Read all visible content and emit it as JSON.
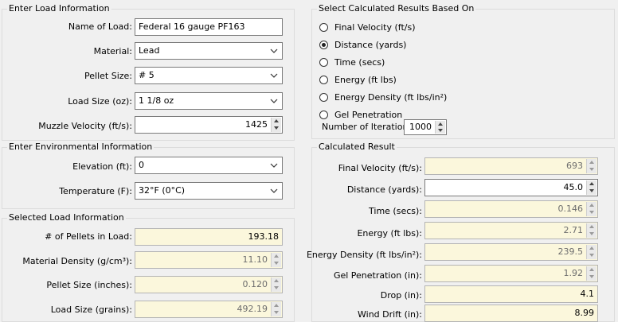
{
  "load_info": {
    "title": "Enter Load Information",
    "name_label": "Name of Load:",
    "name_value": "Federal 16 gauge PF163",
    "material_label": "Material:",
    "material_value": "Lead",
    "pellet_size_label": "Pellet Size:",
    "pellet_size_value": "# 5",
    "load_size_label": "Load Size (oz):",
    "load_size_value": "1 1/8 oz",
    "muzzle_velocity_label": "Muzzle Velocity (ft/s):",
    "muzzle_velocity_value": "1425"
  },
  "environment": {
    "title": "Enter Environmental Information",
    "elevation_label": "Elevation (ft):",
    "elevation_value": "0",
    "temperature_label": "Temperature (F):",
    "temperature_value": "32°F (0°C)"
  },
  "selected_load": {
    "title": "Selected Load Information",
    "pellets_label": "# of Pellets in Load:",
    "pellets_value": "193.18",
    "density_label": "Material Density (g/cm³):",
    "density_value": "11.10",
    "pellet_inches_label": "Pellet Size (inches):",
    "pellet_inches_value": "0.120",
    "grains_label": "Load Size (grains):",
    "grains_value": "492.19"
  },
  "select_results": {
    "title": "Select Calculated Results Based On",
    "options": [
      {
        "label": "Final Velocity (ft/s)",
        "selected": false
      },
      {
        "label": "Distance (yards)",
        "selected": true
      },
      {
        "label": "Time (secs)",
        "selected": false
      },
      {
        "label": "Energy (ft lbs)",
        "selected": false
      },
      {
        "label": "Energy Density (ft lbs/in²)",
        "selected": false
      },
      {
        "label": "Gel Penetration",
        "selected": false
      }
    ],
    "iterations_label": "Number of Iterations:",
    "iterations_value": "1000"
  },
  "calculated": {
    "title": "Calculated Result",
    "final_velocity_label": "Final Velocity (ft/s):",
    "final_velocity_value": "693",
    "distance_label": "Distance (yards):",
    "distance_value": "45.0",
    "time_label": "Time (secs):",
    "time_value": "0.146",
    "energy_label": "Energy (ft lbs):",
    "energy_value": "2.71",
    "energy_density_label": "Energy Density (ft lbs/in²):",
    "energy_density_value": "239.5",
    "gel_label": "Gel Penetration (in):",
    "gel_value": "1.92",
    "drop_label": "Drop (in):",
    "drop_value": "4.1",
    "wind_label": "Wind Drift (in):",
    "wind_value": "8.99"
  }
}
